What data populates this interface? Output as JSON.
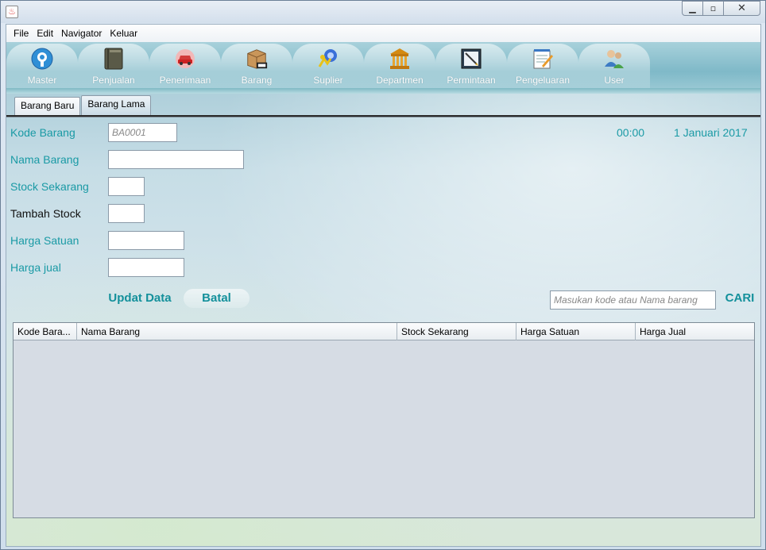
{
  "window": {
    "controls": [
      "minimize-icon",
      "maximize-icon",
      "close-icon"
    ]
  },
  "menubar": [
    "File",
    "Edit",
    "Navigator",
    "Keluar"
  ],
  "navigator": [
    {
      "label": "Master",
      "icon": "master-icon"
    },
    {
      "label": "Penjualan",
      "icon": "book-icon"
    },
    {
      "label": "Penerimaan",
      "icon": "car-icon"
    },
    {
      "label": "Barang",
      "icon": "box-icon"
    },
    {
      "label": "Suplier",
      "icon": "supplier-icon"
    },
    {
      "label": "Departmen",
      "icon": "building-icon"
    },
    {
      "label": "Permintaan",
      "icon": "request-icon"
    },
    {
      "label": "Pengeluaran",
      "icon": "notepad-icon"
    },
    {
      "label": "User",
      "icon": "users-icon"
    }
  ],
  "tabs": [
    {
      "label": "Barang Baru",
      "active": false
    },
    {
      "label": "Barang Lama",
      "active": true
    }
  ],
  "form": {
    "kode_label": "Kode Barang",
    "kode_value": "BA0001",
    "nama_label": "Nama Barang",
    "stock_label": "Stock Sekarang",
    "tambah_label": "Tambah Stock",
    "harga_satuan_label": "Harga Satuan",
    "harga_jual_label": "Harga jual"
  },
  "clock": {
    "time": "00:00",
    "date": "1 Januari 2017"
  },
  "actions": {
    "update": "Updat Data",
    "cancel": "Batal"
  },
  "search": {
    "placeholder": "Masukan kode atau Nama barang",
    "button": "CARI"
  },
  "table": {
    "columns": [
      "Kode Bara...",
      "Nama Barang",
      "Stock Sekarang",
      "Harga Satuan",
      "Harga Jual"
    ],
    "rows": []
  },
  "colors": {
    "accent": "#1a9aa5",
    "button_text": "#13909b"
  }
}
